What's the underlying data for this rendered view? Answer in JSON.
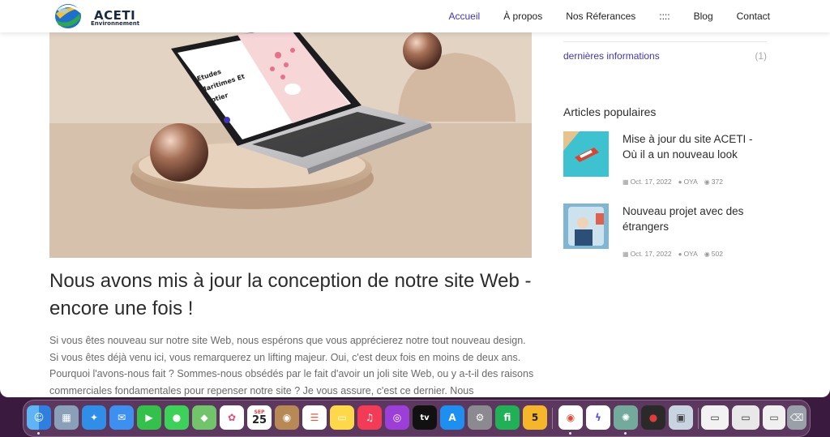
{
  "header": {
    "logo_brand": "ACETI",
    "logo_sub": "Environnement",
    "nav": [
      {
        "label": "Accueil",
        "active": true
      },
      {
        "label": "À propos",
        "active": false
      },
      {
        "label": "Nos Réferances",
        "active": false
      },
      {
        "label": "::::",
        "active": false
      },
      {
        "label": "Blog",
        "active": false
      },
      {
        "label": "Contact",
        "active": false
      }
    ]
  },
  "hero": {
    "screen_title": "Etudes Maritimes Et Cotier"
  },
  "article": {
    "title": "Nous avons mis à jour la conception de notre site Web - encore une fois !",
    "body": "Si vous êtes nouveau sur notre site Web, nous espérons que vous apprécierez notre tout nouveau design. Si vous êtes déjà venu ici, vous remarquerez un lifting majeur. Oui, c'est deux fois en moins de deux ans. Pourquoi l'avons-nous fait ? Sommes-nous obsédés par le fait d'avoir un joli site Web, ou y a-t-il des raisons commerciales fondamentales pour repenser notre site ? Je vous assure, c'est ce dernier. Nous"
  },
  "sidebar": {
    "category": {
      "label": "dernières informations",
      "count": "(1)"
    },
    "popular_heading": "Articles populaires",
    "popular": [
      {
        "title": "Mise à jour du site ACETI - Où il a un nouveau look",
        "date": "Oct. 17, 2022",
        "author": "OYA",
        "views": "372"
      },
      {
        "title": "Nouveau projet avec des étrangers",
        "date": "Oct. 17, 2022",
        "author": "OYA",
        "views": "502"
      }
    ]
  },
  "dock": {
    "calendar_month": "SEP",
    "calendar_day": "25",
    "appletv_label": "tv",
    "badge_label": "5"
  }
}
